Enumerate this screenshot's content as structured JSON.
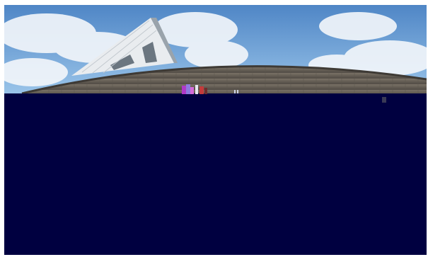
{
  "image": {
    "kind": "photograph",
    "alt": "",
    "colors": {
      "sky_top": "#4f86c6",
      "sky_bottom": "#9cc6ea",
      "cloud": "#f4f7fb",
      "tower_light": "#e9ecef",
      "tower_dark": "#9aa3ab",
      "wall": "#6e675c",
      "wall_shadow": "#4b463f",
      "corrupted_block": "#000040"
    }
  }
}
